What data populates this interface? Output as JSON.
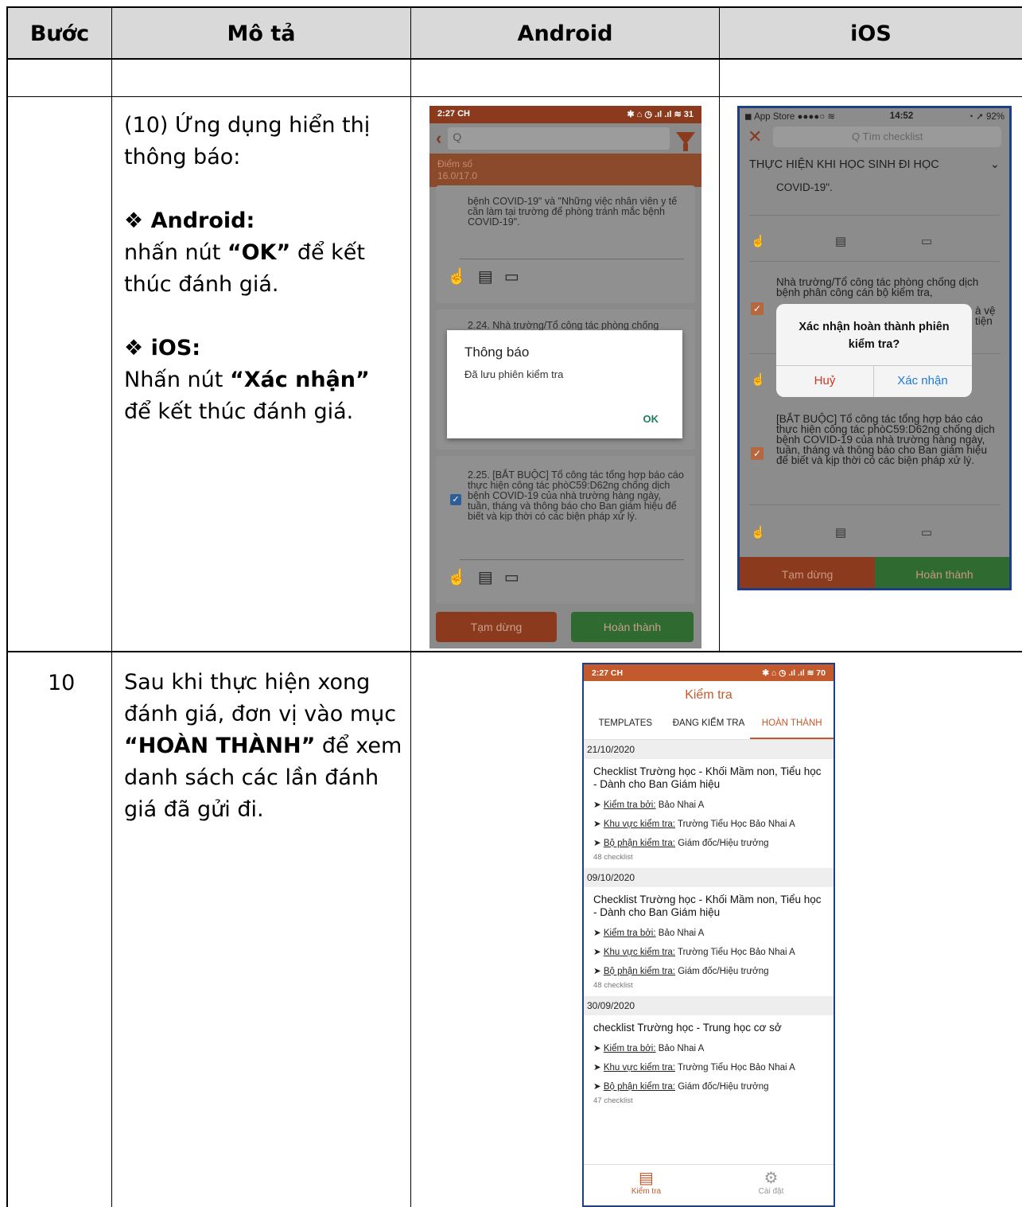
{
  "table": {
    "headers": [
      "Bước",
      "Mô tả",
      "Android",
      "iOS"
    ],
    "row1": {
      "intro": "(10) Ứng dụng hiển thị thông báo:",
      "android_head": "❖ Android:",
      "android_pre": "nhấn nút ",
      "android_bold": "“OK”",
      "android_post": " để kết thúc đánh giá.",
      "ios_head": "❖ iOS:",
      "ios_pre": "Nhấn nút ",
      "ios_bold": "“Xác nhận”",
      "ios_post": " để kết thúc đánh giá."
    },
    "row2": {
      "step": "10",
      "pre": "Sau khi thực hiện xong đánh giá, đơn vị vào mục ",
      "bold": "“HOÀN THÀNH”",
      "post": " để xem danh sách các lần đánh giá đã gửi đi."
    }
  },
  "android": {
    "time": "2:27 CH",
    "status_icons": "✱ ⌂ ◷ .ıl .ıl ≋ 31",
    "search_placeholder": "Q",
    "score_label": "Điểm số",
    "score_value": "16.0/17.0",
    "card1_text": "bệnh COVID-19\" và \"Những việc nhân viên y tế cần làm tại trường để phòng tránh mắc bệnh COVID-19\".",
    "card2_text": "2.24. Nhà trường/Tổ công tác phòng chống",
    "card3_text": "2.25. [BẮT BUỘC] Tổ công tác tổng hợp báo cáo thực hiện công tác phòC59:D62ng chống dịch bệnh COVID-19 của nhà trường hàng ngày, tuần, tháng và thông báo cho Ban giám hiệu để biết và kịp thời có các biện pháp xử lý.",
    "dialog_title": "Thông báo",
    "dialog_message": "Đã lưu phiên kiểm tra",
    "dialog_ok": "OK",
    "pause_label": "Tạm dừng",
    "finish_label": "Hoàn thành"
  },
  "ios": {
    "carrier": "◼ App Store ●●●●○ ≋",
    "time": "14:52",
    "battery": "◔ ➚ 92%",
    "search_placeholder": "Q Tìm checklist",
    "section": "THỰC HIỆN KHI HỌC SINH ĐI HỌC",
    "text1": "COVID-19\".",
    "text2": "Nhà trường/Tổ công tác phòng chống dịch bệnh phân công cán bộ kiểm tra,",
    "text2_tail_a": "à vệ",
    "text2_tail_b": "tiện",
    "text3": "[BẮT BUỘC] Tổ công tác tổng hợp báo cáo thực hiện công tác phòC59:D62ng chống dịch bệnh COVID-19 của nhà trường hàng ngày, tuần, tháng và thông báo cho Ban giám hiệu để biết và kịp thời có các biện pháp xử lý.",
    "dialog_title": "Xác nhận hoàn thành phiên kiểm tra?",
    "cancel_label": "Huỷ",
    "confirm_label": "Xác nhận",
    "pause_label": "Tạm dừng",
    "finish_label": "Hoàn thành",
    "colors": {
      "cancel": "#d0331f",
      "confirm": "#1a7ad9"
    }
  },
  "list": {
    "time": "2:27 CH",
    "status_icons": "✱ ⌂ ◷ .ıl .ıl ≋ 70",
    "title": "Kiểm tra",
    "tabs": [
      "TEMPLATES",
      "ĐANG KIỂM TRA",
      "HOÀN THÀNH"
    ],
    "groups": [
      {
        "date": "21/10/2020",
        "name": "Checklist Trường học - Khối Mầm non, Tiểu học - Dành cho Ban Giám hiệu",
        "inspector_key": "Kiểm tra bởi:",
        "inspector_val": "Bảo Nhai A",
        "area_key": "Khu vực kiểm tra:",
        "area_val": "Trường Tiểu Học Bảo Nhai A",
        "dept_key": "Bộ phận kiểm tra:",
        "dept_val": "Giám đốc/Hiệu trưởng",
        "count": "48 checklist"
      },
      {
        "date": "09/10/2020",
        "name": "Checklist Trường học - Khối Mầm non, Tiểu học - Dành cho Ban Giám hiệu",
        "inspector_key": "Kiểm tra bởi:",
        "inspector_val": "Bảo Nhai A",
        "area_key": "Khu vực kiểm tra:",
        "area_val": "Trường Tiểu Học Bảo Nhai A",
        "dept_key": "Bộ phận kiểm tra:",
        "dept_val": "Giám đốc/Hiệu trưởng",
        "count": "48 checklist"
      },
      {
        "date": "30/09/2020",
        "name": "checklist Trường học - Trung học cơ sở",
        "inspector_key": "Kiểm tra bởi:",
        "inspector_val": "Bảo Nhai A",
        "area_key": "Khu vực kiểm tra:",
        "area_val": "Trường Tiểu Học Bảo Nhai A",
        "dept_key": "Bộ phận kiểm tra:",
        "dept_val": "Giám đốc/Hiệu trưởng",
        "count": "47 checklist"
      }
    ],
    "nav": [
      {
        "icon": "checklist-icon",
        "label": "Kiểm tra"
      },
      {
        "icon": "gear-icon",
        "label": "Cài đặt"
      }
    ]
  },
  "colors": {
    "header_bg": "#d9d9d9",
    "brand_orange": "#c25a2e",
    "finish_green": "#2f7d32"
  }
}
